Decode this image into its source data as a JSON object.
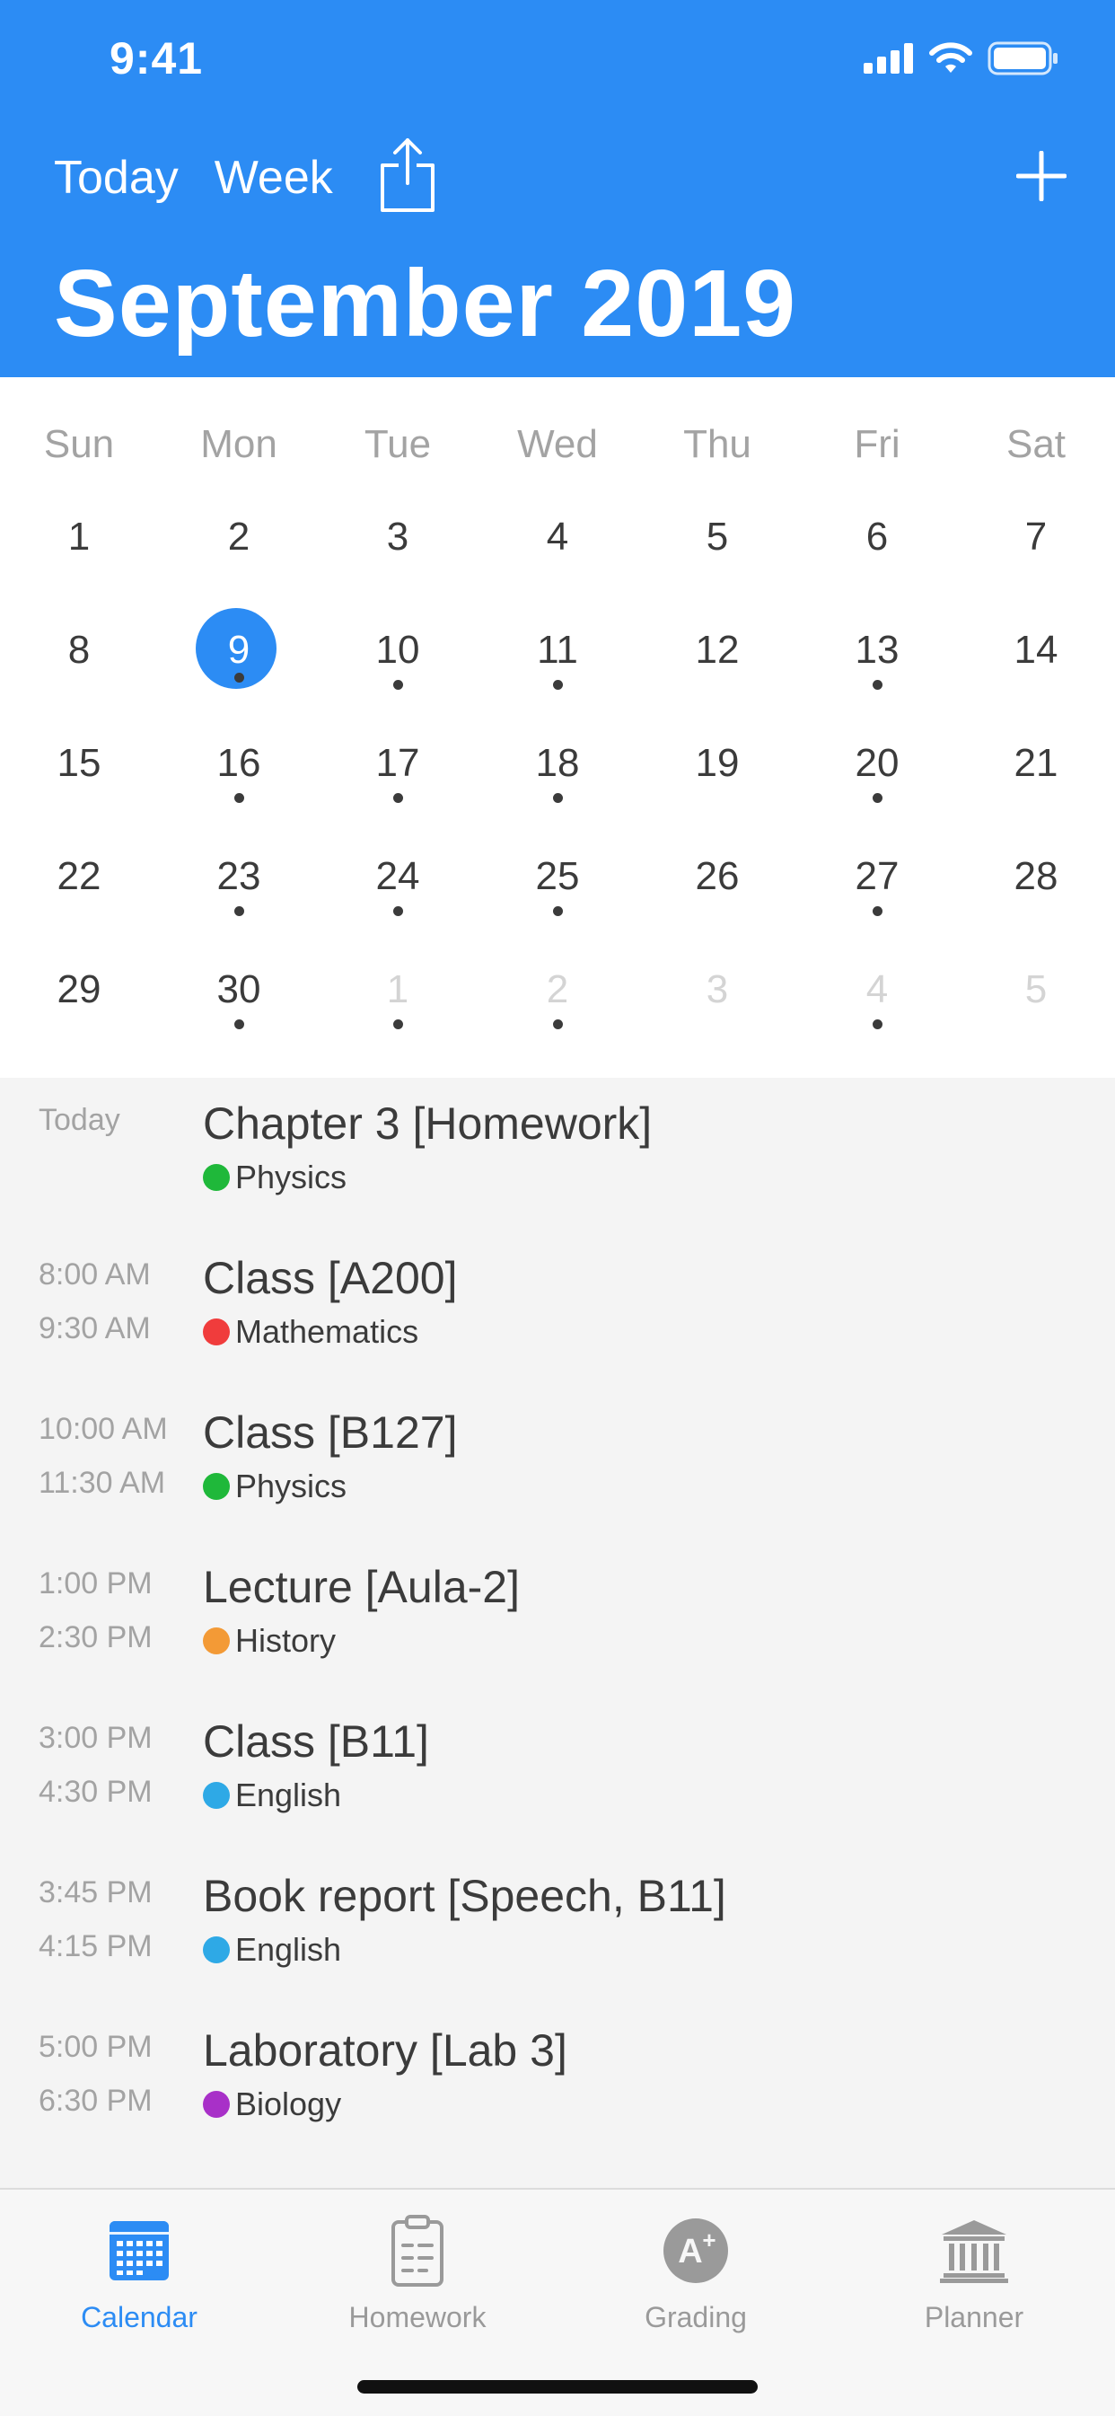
{
  "status_bar": {
    "time": "9:41"
  },
  "header": {
    "today_label": "Today",
    "week_label": "Week",
    "title": "September 2019",
    "accent_color": "#2c8cf4"
  },
  "calendar": {
    "weekdays": [
      "Sun",
      "Mon",
      "Tue",
      "Wed",
      "Thu",
      "Fri",
      "Sat"
    ],
    "selected_day": "9",
    "weeks": [
      [
        {
          "d": "1"
        },
        {
          "d": "2"
        },
        {
          "d": "3"
        },
        {
          "d": "4"
        },
        {
          "d": "5"
        },
        {
          "d": "6"
        },
        {
          "d": "7"
        }
      ],
      [
        {
          "d": "8"
        },
        {
          "d": "9",
          "sel": true,
          "dot": true
        },
        {
          "d": "10",
          "dot": true
        },
        {
          "d": "11",
          "dot": true
        },
        {
          "d": "12"
        },
        {
          "d": "13",
          "dot": true
        },
        {
          "d": "14"
        }
      ],
      [
        {
          "d": "15"
        },
        {
          "d": "16",
          "dot": true
        },
        {
          "d": "17",
          "dot": true
        },
        {
          "d": "18",
          "dot": true
        },
        {
          "d": "19"
        },
        {
          "d": "20",
          "dot": true
        },
        {
          "d": "21"
        }
      ],
      [
        {
          "d": "22"
        },
        {
          "d": "23",
          "dot": true
        },
        {
          "d": "24",
          "dot": true
        },
        {
          "d": "25",
          "dot": true
        },
        {
          "d": "26"
        },
        {
          "d": "27",
          "dot": true
        },
        {
          "d": "28"
        }
      ],
      [
        {
          "d": "29"
        },
        {
          "d": "30",
          "dot": true
        },
        {
          "d": "1",
          "muted": true,
          "dot": true
        },
        {
          "d": "2",
          "muted": true,
          "dot": true
        },
        {
          "d": "3",
          "muted": true
        },
        {
          "d": "4",
          "muted": true,
          "dot": true
        },
        {
          "d": "5",
          "muted": true
        }
      ]
    ]
  },
  "events": [
    {
      "time1": "Today",
      "time2": "",
      "title": "Chapter 3 [Homework]",
      "subject": "Physics",
      "color": "#1fb83a"
    },
    {
      "time1": "8:00 AM",
      "time2": "9:30 AM",
      "title": "Class [A200]",
      "subject": "Mathematics",
      "color": "#f03c3c"
    },
    {
      "time1": "10:00 AM",
      "time2": "11:30 AM",
      "title": "Class [B127]",
      "subject": "Physics",
      "color": "#1fb83a"
    },
    {
      "time1": "1:00 PM",
      "time2": "2:30 PM",
      "title": "Lecture [Aula-2]",
      "subject": "History",
      "color": "#f39a36"
    },
    {
      "time1": "3:00 PM",
      "time2": "4:30 PM",
      "title": "Class [B11]",
      "subject": "English",
      "color": "#2ea9e6"
    },
    {
      "time1": "3:45 PM",
      "time2": "4:15 PM",
      "title": "Book report [Speech, B11]",
      "subject": "English",
      "color": "#2ea9e6"
    },
    {
      "time1": "5:00 PM",
      "time2": "6:30 PM",
      "title": "Laboratory [Lab 3]",
      "subject": "Biology",
      "color": "#a830c8"
    }
  ],
  "tabbar": {
    "tabs": [
      {
        "label": "Calendar",
        "icon": "calendar-icon",
        "active": true
      },
      {
        "label": "Homework",
        "icon": "clipboard-icon",
        "active": false
      },
      {
        "label": "Grading",
        "icon": "grade-a-plus-icon",
        "active": false
      },
      {
        "label": "Planner",
        "icon": "institution-icon",
        "active": false
      }
    ]
  }
}
